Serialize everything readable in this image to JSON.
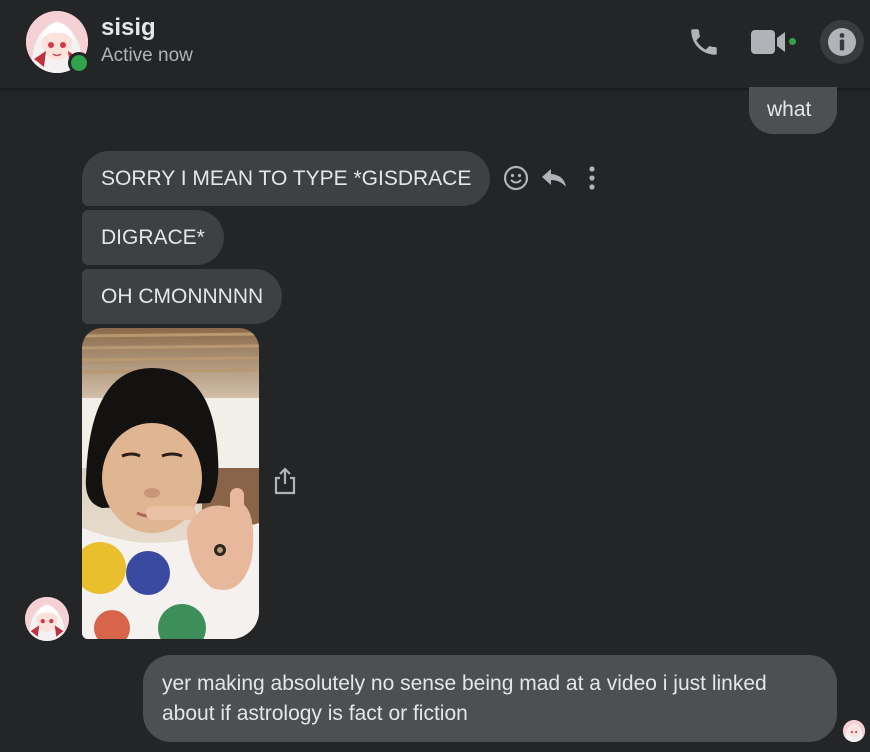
{
  "header": {
    "contact_name": "sisig",
    "status": "Active now",
    "icons": [
      "phone-icon",
      "video-icon",
      "info-icon"
    ]
  },
  "messages": {
    "sent_1": "what",
    "received_1": "SORRY I MEAN TO TYPE *GISDRACE",
    "received_2": "DIGRACE*",
    "received_3": "OH CMONNNNN",
    "received_4_type": "photo",
    "sent_2": "yer making absolutely no sense being mad at a video i just linked about if astrology is fact or fiction"
  },
  "message_actions": [
    "react-icon",
    "reply-icon",
    "more-icon"
  ],
  "colors": {
    "background": "#242526",
    "bubble_received": "#3e4042",
    "bubble_sent": "#4e4f50",
    "text": "#e4e6eb",
    "secondary_text": "#b0b3b8",
    "presence": "#31a24c"
  }
}
